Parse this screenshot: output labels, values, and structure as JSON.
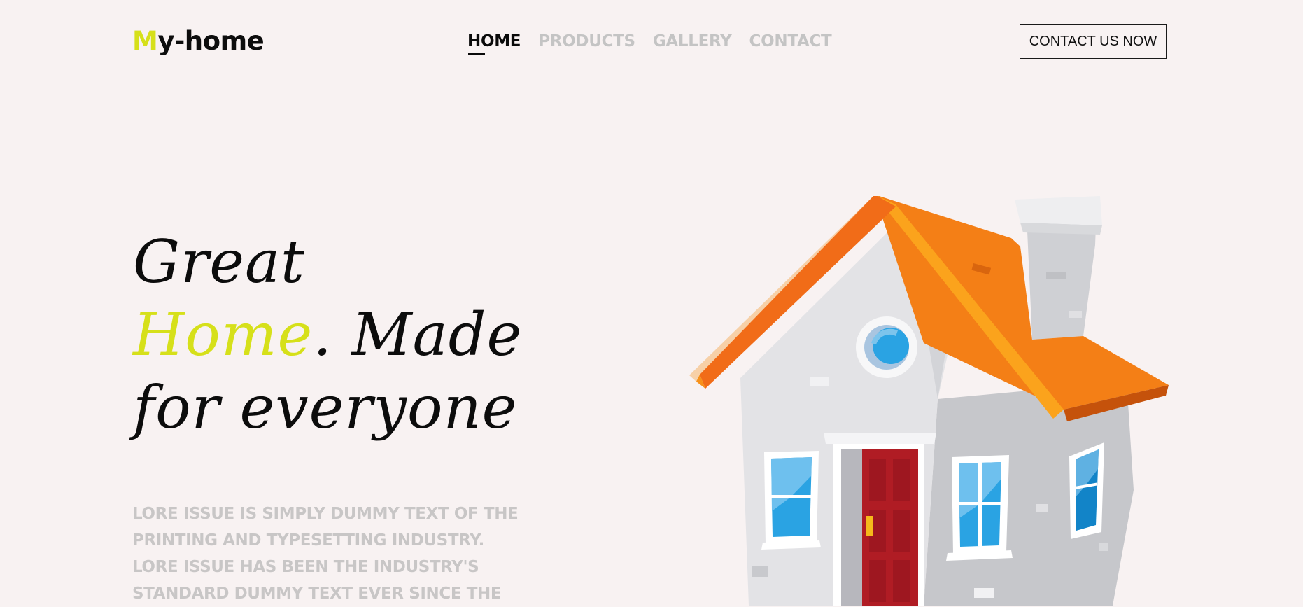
{
  "header": {
    "logo_first_letter": "M",
    "logo_rest": "y-home",
    "cta_label": "CONTACT US NOW"
  },
  "nav": {
    "items": [
      "HOME",
      "PRODUCTS",
      "GALLERY",
      "CONTACT"
    ],
    "active": "HOME"
  },
  "hero": {
    "line1": "Great",
    "line2_accent": "Home",
    "line2_rest": ". Made",
    "line3": "for everyone",
    "description": "LORE ISSUE IS SIMPLY DUMMY TEXT OF THE PRINTING AND TYPESETTING INDUSTRY. LORE ISSUE HAS BEEN THE INDUSTRY'S STANDARD DUMMY TEXT EVER SINCE THE"
  },
  "colors": {
    "accent": "#d6e01a",
    "background": "#f8f2f2",
    "nav_inactive": "#c4c4c4",
    "roof": "#f47f16",
    "door": "#b01c24",
    "window": "#2aa3e3"
  },
  "icons": [
    "house-illustration"
  ]
}
